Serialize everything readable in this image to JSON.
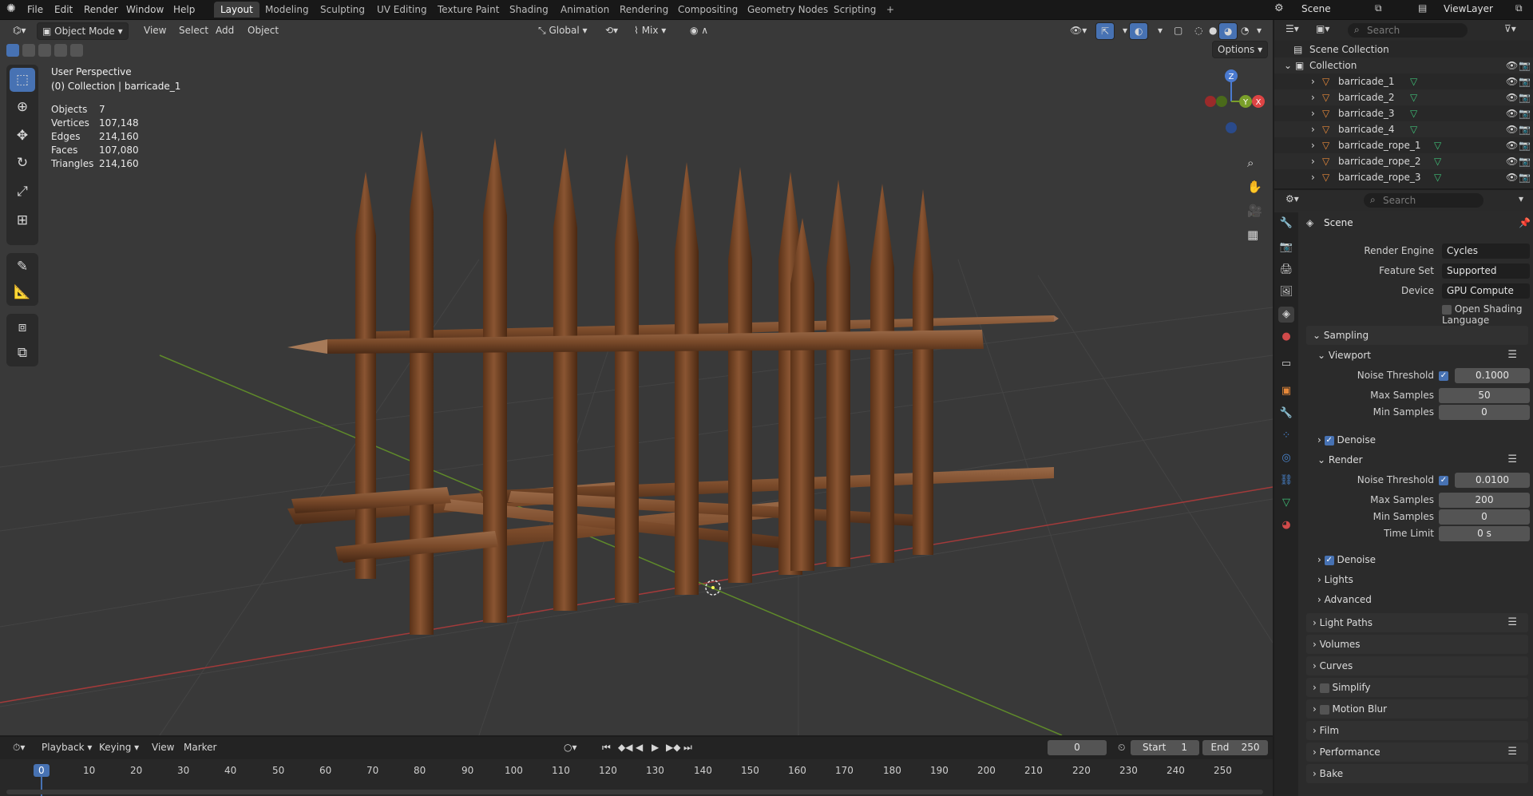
{
  "menu": [
    "File",
    "Edit",
    "Render",
    "Window",
    "Help"
  ],
  "workspaces": [
    "Layout",
    "Modeling",
    "Sculpting",
    "UV Editing",
    "Texture Paint",
    "Shading",
    "Animation",
    "Rendering",
    "Compositing",
    "Geometry Nodes",
    "Scripting"
  ],
  "top_right": {
    "scene": "Scene",
    "view_layer": "ViewLayer"
  },
  "viewport_header": {
    "mode": "Object Mode",
    "view": "View",
    "select": "Select",
    "add": "Add",
    "object": "Object",
    "orientation": "Global",
    "snap": "Mix",
    "options": "Options"
  },
  "overlay": {
    "perspective": "User Perspective",
    "collection": "(0) Collection | barricade_1",
    "stats": [
      {
        "label": "Objects",
        "value": "7"
      },
      {
        "label": "Vertices",
        "value": "107,148"
      },
      {
        "label": "Edges",
        "value": "214,160"
      },
      {
        "label": "Faces",
        "value": "107,080"
      },
      {
        "label": "Triangles",
        "value": "214,160"
      }
    ]
  },
  "gizmo": {
    "z": "Z",
    "y": "Y",
    "x": "X"
  },
  "outliner": {
    "search_placeholder": "Search",
    "scene_collection": "Scene Collection",
    "collection": "Collection",
    "items": [
      "barricade_1",
      "barricade_2",
      "barricade_3",
      "barricade_4",
      "barricade_rope_1",
      "barricade_rope_2",
      "barricade_rope_3"
    ]
  },
  "properties": {
    "search_placeholder": "Search",
    "context": "Scene",
    "render_engine": {
      "label": "Render Engine",
      "value": "Cycles"
    },
    "feature_set": {
      "label": "Feature Set",
      "value": "Supported"
    },
    "device": {
      "label": "Device",
      "value": "GPU Compute"
    },
    "osl": "Open Shading Language",
    "sampling": "Sampling",
    "viewport": {
      "title": "Viewport",
      "noise_threshold": {
        "label": "Noise Threshold",
        "value": "0.1000"
      },
      "max_samples": {
        "label": "Max Samples",
        "value": "50"
      },
      "min_samples": {
        "label": "Min Samples",
        "value": "0"
      },
      "denoise": "Denoise"
    },
    "render": {
      "title": "Render",
      "noise_threshold": {
        "label": "Noise Threshold",
        "value": "0.0100"
      },
      "max_samples": {
        "label": "Max Samples",
        "value": "200"
      },
      "min_samples": {
        "label": "Min Samples",
        "value": "0"
      },
      "time_limit": {
        "label": "Time Limit",
        "value": "0 s"
      },
      "denoise": "Denoise"
    },
    "lights": "Lights",
    "advanced": "Advanced",
    "panels": [
      "Light Paths",
      "Volumes",
      "Curves",
      "Simplify",
      "Motion Blur",
      "Film",
      "Performance",
      "Bake"
    ]
  },
  "timeline": {
    "playback": "Playback",
    "keying": "Keying",
    "view": "View",
    "marker": "Marker",
    "current_frame": "0",
    "start_label": "Start",
    "start": "1",
    "end_label": "End",
    "end": "250",
    "ruler": [
      "0",
      "10",
      "20",
      "30",
      "40",
      "50",
      "60",
      "70",
      "80",
      "90",
      "100",
      "110",
      "120",
      "130",
      "140",
      "150",
      "160",
      "170",
      "180",
      "190",
      "200",
      "210",
      "220",
      "230",
      "240",
      "250"
    ]
  }
}
